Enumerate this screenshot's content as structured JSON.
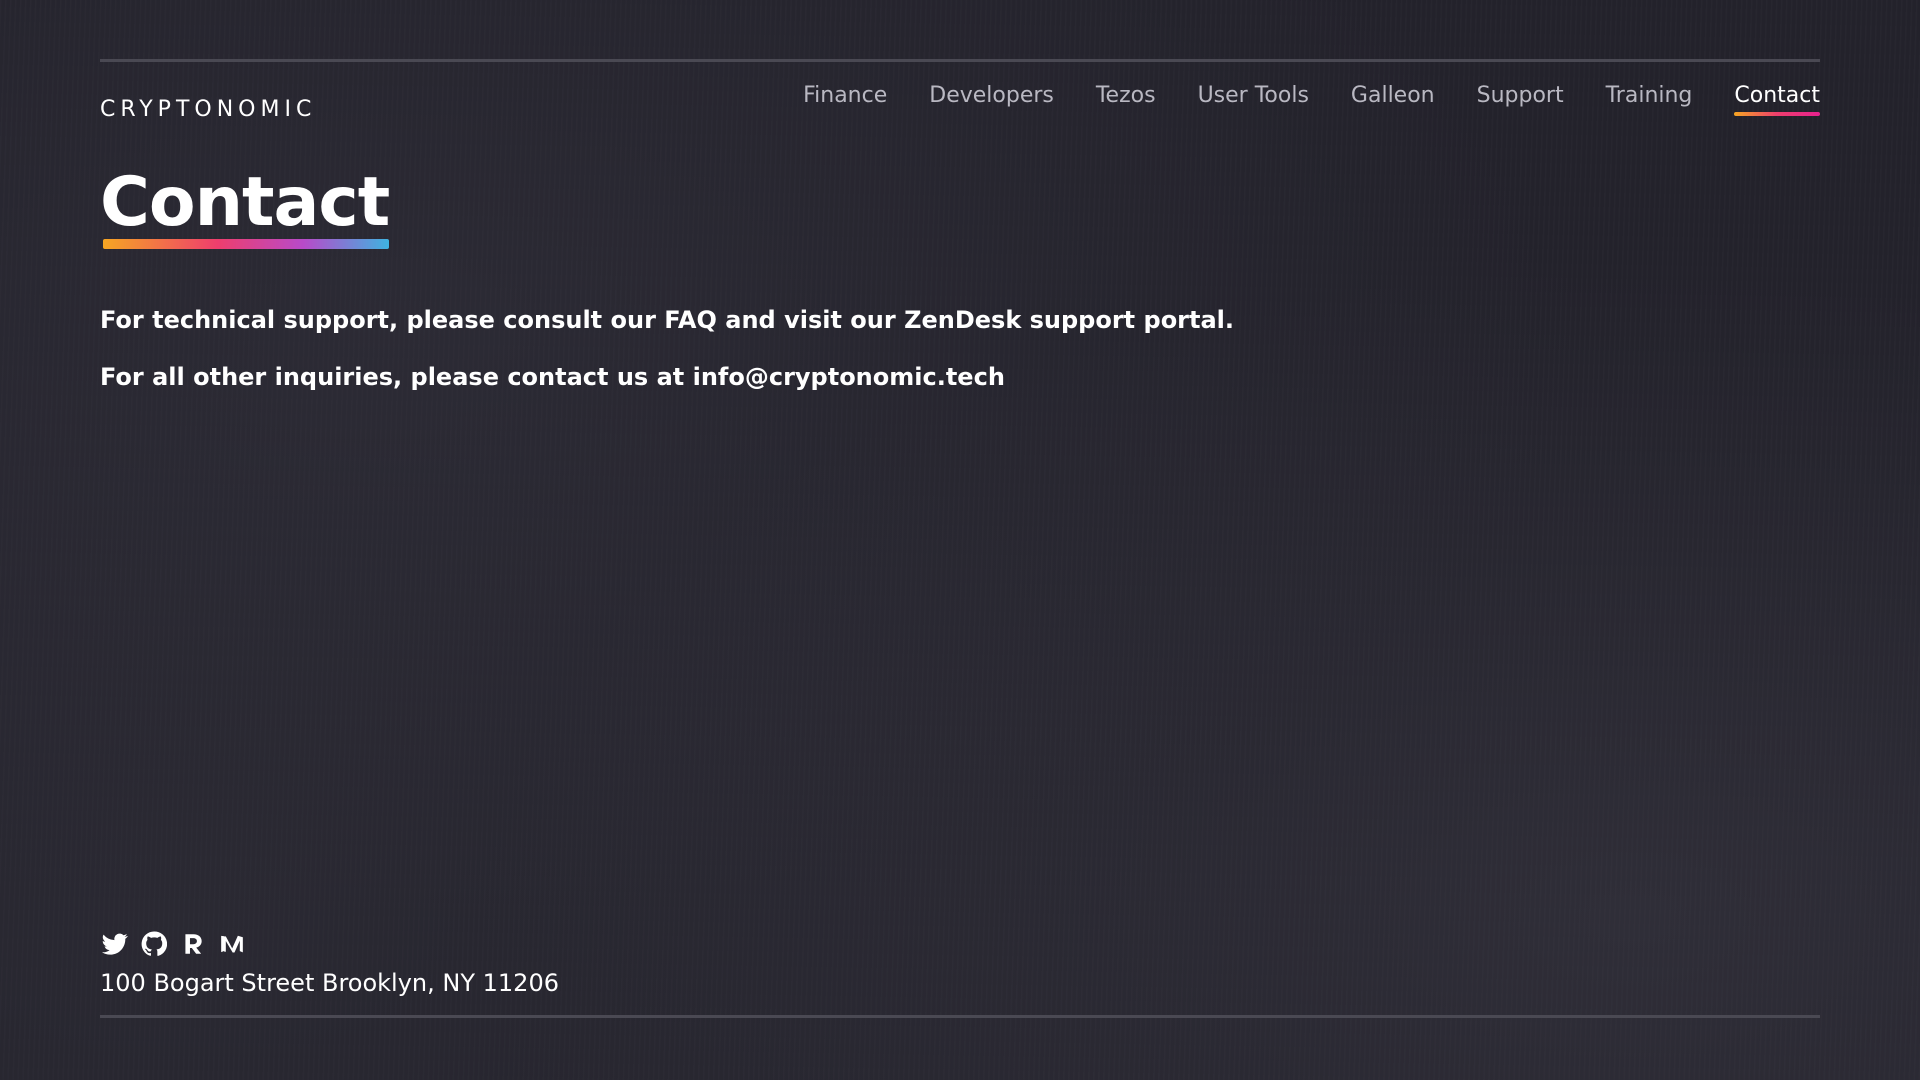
{
  "brand": {
    "logo_text": "CRYPTONOMIC"
  },
  "nav": {
    "items": [
      {
        "label": "Finance",
        "active": false
      },
      {
        "label": "Developers",
        "active": false
      },
      {
        "label": "Tezos",
        "active": false
      },
      {
        "label": "User Tools",
        "active": false
      },
      {
        "label": "Galleon",
        "active": false
      },
      {
        "label": "Support",
        "active": false
      },
      {
        "label": "Training",
        "active": false
      },
      {
        "label": "Contact",
        "active": true
      }
    ],
    "active_underline_colors": [
      "#f6a623",
      "#ee3e6d",
      "#e8218f"
    ]
  },
  "page": {
    "title": "Contact",
    "title_underline_colors": [
      "#f6a623",
      "#ee3e6d",
      "#b84ac9",
      "#3fb3e0"
    ]
  },
  "content": {
    "support_line": {
      "prefix": "For technical support, please consult our ",
      "faq_link": "FAQ",
      "middle": " and visit our ",
      "zendesk_link": "ZenDesk support portal",
      "suffix": "."
    },
    "inquiries_line": {
      "prefix": "For all other inquiries, please contact us at ",
      "email_link": "info@cryptonomic.tech"
    }
  },
  "footer": {
    "social_icons": [
      "twitter-icon",
      "github-icon",
      "riot-icon",
      "medium-icon"
    ],
    "address": "100 Bogart Street Brooklyn, NY 11206"
  },
  "colors": {
    "background": "#23222b",
    "rule": "#4a4953",
    "nav_inactive": "#b9b8c2",
    "text": "#ffffff"
  }
}
